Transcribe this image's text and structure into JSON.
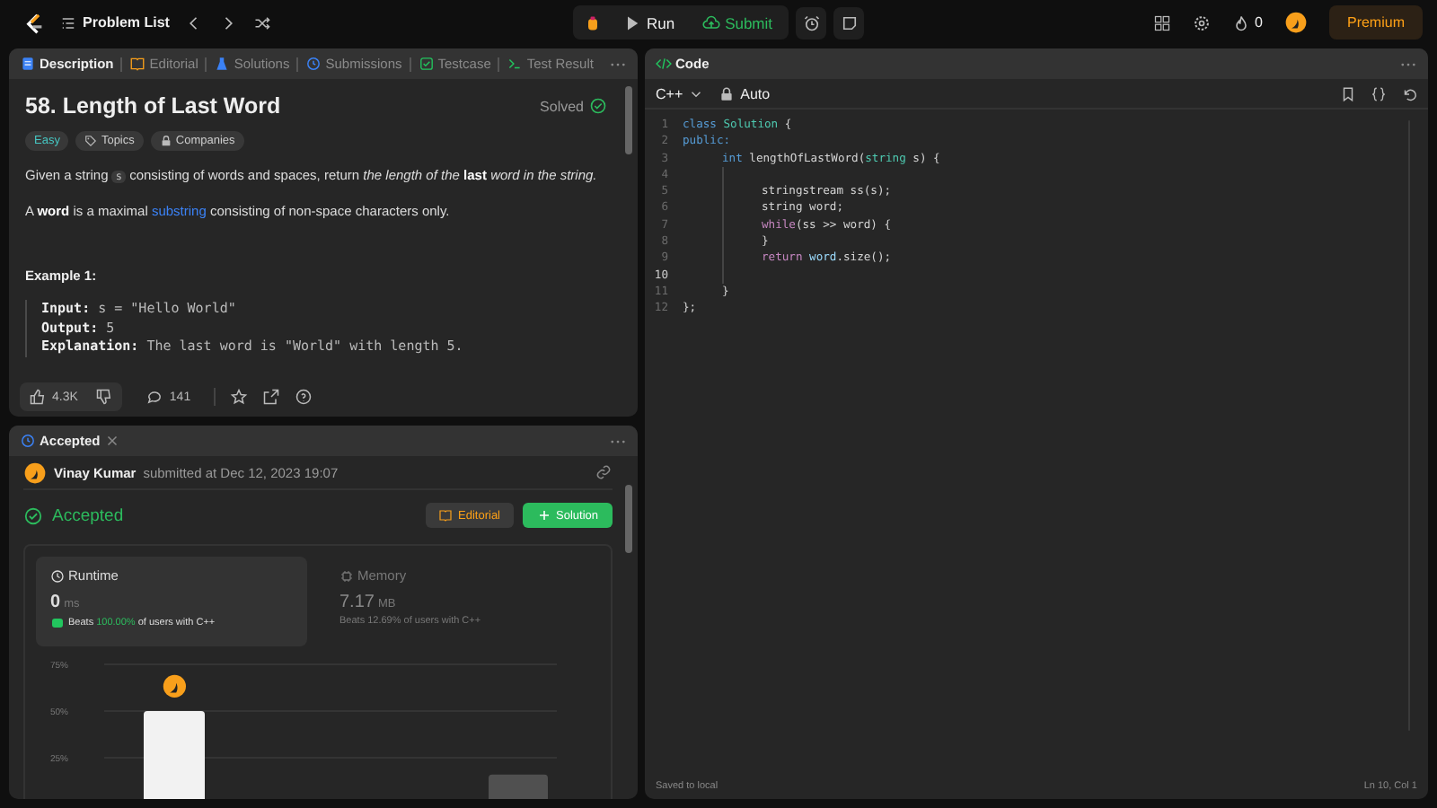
{
  "topbar": {
    "problem_list": "Problem List",
    "run": "Run",
    "submit": "Submit",
    "streak": "0",
    "premium": "Premium"
  },
  "description_panel": {
    "tabs": [
      {
        "label": "Description",
        "selected": true
      },
      {
        "label": "Editorial",
        "selected": false
      },
      {
        "label": "Solutions",
        "selected": false
      },
      {
        "label": "Submissions",
        "selected": false
      },
      {
        "label": "Testcase",
        "selected": false
      },
      {
        "label": "Test Result",
        "selected": false
      }
    ],
    "title": "58. Length of Last Word",
    "status": "Solved",
    "tags": [
      {
        "label": "Easy",
        "kind": "difficulty"
      },
      {
        "label": "Topics",
        "kind": "topics"
      },
      {
        "label": "Companies",
        "kind": "companies"
      }
    ],
    "paragraphs": [
      [
        {
          "kind": "text",
          "text": "Given a string "
        },
        {
          "kind": "code",
          "text": "s"
        },
        {
          "kind": "text",
          "text": " consisting of words and spaces, return *the length of the* **last** *word in the string.*"
        }
      ],
      [
        {
          "kind": "text",
          "text": "A **word** is a maximal "
        },
        {
          "kind": "link",
          "text": "substring"
        },
        {
          "kind": "text",
          "text": " consisting of non-space characters only."
        }
      ]
    ],
    "example_title": "Example 1:",
    "example_lines": [
      {
        "label": "Input:",
        "value": "s = \"Hello World\""
      },
      {
        "label": "Output:",
        "value": "5"
      },
      {
        "label": "Explanation:",
        "value": "The last word is \"World\" with length 5."
      }
    ],
    "likes": "4.3K",
    "comments": "141"
  },
  "submission_panel": {
    "tab": "Accepted",
    "user": "Vinay Kumar",
    "submitted": "submitted at Dec 12, 2023 19:07",
    "verdict": "Accepted",
    "editorial_button": "Editorial",
    "solution_button": "Solution",
    "metrics": [
      {
        "title": "Runtime",
        "value": "0",
        "unit": "ms",
        "beats_prefix": "Beats",
        "beats": "100.00%",
        "beats_suffix": "of users with C++",
        "selected": true
      },
      {
        "title": "Memory",
        "value": "7.17",
        "unit": "MB",
        "beats_prefix": "Beats",
        "beats": "12.69%",
        "beats_suffix": "of users with C++",
        "selected": false
      }
    ],
    "chart_data": {
      "type": "bar",
      "values": [
        50,
        16
      ],
      "yticks": [
        {
          "value": 25,
          "label": "25%"
        },
        {
          "value": 50,
          "label": "50%"
        },
        {
          "value": 75,
          "label": "75%"
        }
      ],
      "ylim": [
        0,
        75
      ]
    }
  },
  "code_panel": {
    "tab": "Code",
    "language": "C++",
    "mode": "Auto",
    "lines": [
      {
        "number": "1",
        "tokens": [
          {
            "kind": "keyword",
            "text": "class "
          },
          {
            "kind": "type",
            "text": "Solution"
          },
          {
            "kind": "plain",
            "text": " {"
          }
        ]
      },
      {
        "number": "2",
        "tokens": [
          {
            "kind": "keyword",
            "text": "public:"
          }
        ],
        "children": [
          {
            "number": "3",
            "tokens": [
              {
                "kind": "keyword",
                "text": "int "
              },
              {
                "kind": "plain",
                "text": "lengthOfLastWord("
              },
              {
                "kind": "type",
                "text": "string"
              },
              {
                "kind": "plain",
                "text": " s) {"
              }
            ],
            "children": [
              {
                "number": "4",
                "current": false
              },
              {
                "number": "5",
                "current": false,
                "tokens": [
                  {
                    "kind": "plain",
                    "text": "stringstream ss(s);"
                  }
                ]
              },
              {
                "number": "6",
                "current": false,
                "tokens": [
                  {
                    "kind": "plain",
                    "text": "string word;"
                  }
                ]
              },
              {
                "number": "7",
                "current": false,
                "tokens": [
                  {
                    "kind": "control",
                    "text": "while"
                  },
                  {
                    "kind": "plain",
                    "text": "(ss >> word) {"
                  }
                ]
              },
              {
                "number": "8",
                "current": false,
                "tokens": [
                  {
                    "kind": "plain",
                    "text": "}"
                  }
                ]
              },
              {
                "number": "9",
                "current": false,
                "tokens": [
                  {
                    "kind": "control",
                    "text": "return "
                  },
                  {
                    "kind": "var",
                    "text": "word"
                  },
                  {
                    "kind": "plain",
                    "text": ".size();"
                  }
                ]
              },
              {
                "number": "10",
                "current": true
              }
            ]
          },
          {
            "number": "11",
            "tokens": [
              {
                "kind": "plain",
                "text": "}"
              }
            ]
          }
        ]
      },
      {
        "number": "12",
        "tokens": [
          {
            "kind": "plain",
            "text": "};"
          }
        ]
      }
    ],
    "saved": "Saved to local",
    "cursor": "Ln 10, Col 1"
  }
}
